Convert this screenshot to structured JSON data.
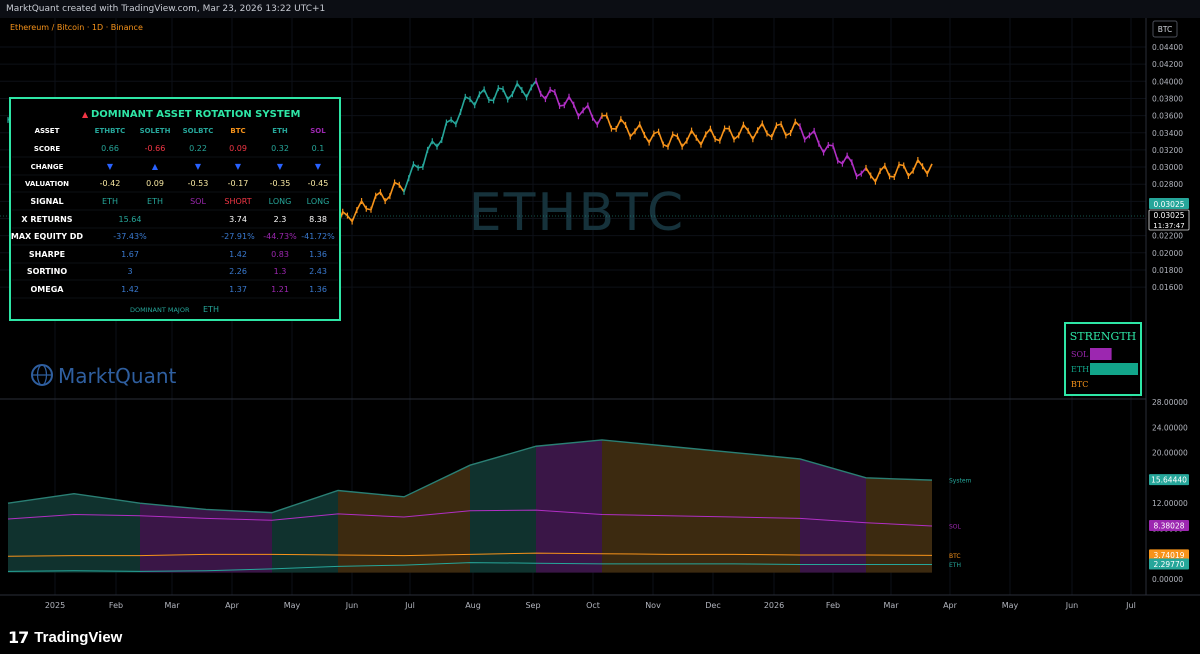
{
  "header": {
    "attribution": "MarktQuant created with TradingView.com, Mar 23, 2026 13:22 UTC+1"
  },
  "symbol": {
    "title": "Ethereum / Bitcoin · 1D · Binance",
    "watermark": "ETHBTC",
    "currency_badge": "BTC"
  },
  "brand": {
    "name": "MarktQuant"
  },
  "price_axis": {
    "ticks": [
      "0.04400",
      "0.04200",
      "0.04000",
      "0.03800",
      "0.03600",
      "0.03400",
      "0.03200",
      "0.03000",
      "0.02800",
      "0.02600",
      "0.02400",
      "0.02200",
      "0.02000",
      "0.01800",
      "0.01600"
    ],
    "last_price": "0.03025",
    "last_price_2": "0.03025",
    "countdown": "11:37:47"
  },
  "indicator_axis": {
    "ticks": [
      "28.00000",
      "24.00000",
      "20.00000",
      "16.00000",
      "12.00000",
      "8.00000",
      "4.00000",
      "0.00000"
    ],
    "labels": [
      {
        "name": "System",
        "value": "15.64440",
        "color": "#26a69a"
      },
      {
        "name": "SOL",
        "value": "8.38028",
        "color": "#9c27b0"
      },
      {
        "name": "BTC",
        "value": "3.74019",
        "color": "#f7931a"
      },
      {
        "name": "ETH",
        "value": "2.29770",
        "color": "#26a69a"
      }
    ]
  },
  "time_axis": [
    "2025",
    "Feb",
    "Mar",
    "Apr",
    "May",
    "Jun",
    "Jul",
    "Aug",
    "Sep",
    "Oct",
    "Nov",
    "Dec",
    "2026",
    "Feb",
    "Mar",
    "Apr",
    "May",
    "Jun",
    "Jul"
  ],
  "table": {
    "title": "DOMINANT ASSET ROTATION SYSTEM",
    "header": [
      "ASSET",
      "ETHBTC",
      "SOLETH",
      "SOLBTC",
      "BTC",
      "ETH",
      "SOL"
    ],
    "rows": [
      {
        "label": "SCORE",
        "cells": [
          "0.66",
          "-0.66",
          "0.22",
          "0.09",
          "0.32",
          "0.1"
        ]
      },
      {
        "label": "CHANGE",
        "cells": [
          "▼",
          "▲",
          "▼",
          "▼",
          "▼",
          "▼"
        ]
      },
      {
        "label": "VALUATION",
        "cells": [
          "-0.42",
          "0.09",
          "-0.53",
          "-0.17",
          "-0.35",
          "-0.45"
        ]
      },
      {
        "label": "SIGNAL",
        "cells": [
          "ETH",
          "ETH",
          "SOL",
          "SHORT",
          "LONG",
          "LONG"
        ]
      },
      {
        "label": "X RETURNS",
        "cells": [
          "15.64",
          "3.74",
          "2.3",
          "8.38"
        ]
      },
      {
        "label": "MAX EQUITY DD",
        "cells": [
          "-37.43%",
          "-27.91%",
          "-44.73%",
          "-41.72%"
        ]
      },
      {
        "label": "SHARPE",
        "cells": [
          "1.67",
          "1.42",
          "0.83",
          "1.36"
        ]
      },
      {
        "label": "SORTINO",
        "cells": [
          "3",
          "2.26",
          "1.3",
          "2.43"
        ]
      },
      {
        "label": "OMEGA",
        "cells": [
          "1.42",
          "1.37",
          "1.21",
          "1.36"
        ]
      }
    ],
    "footer_label": "DOMINANT MAJOR",
    "footer_value": "ETH"
  },
  "strength": {
    "title": "STRENGTH",
    "items": [
      {
        "label": "SOL",
        "level": 0.45,
        "color": "#9c27b0"
      },
      {
        "label": "ETH",
        "level": 1.0,
        "color": "#12a58a"
      },
      {
        "label": "BTC",
        "level": 0.0,
        "color": "#f7931a"
      }
    ]
  },
  "footer": {
    "brand": "TradingView"
  },
  "colors": {
    "eth": "#26a69a",
    "sol": "#b02fc4",
    "btc": "#f7931a",
    "accent": "#2ee6a6",
    "bg": "#000000"
  },
  "chart_data": {
    "type": "line",
    "title": "Ethereum / Bitcoin · 1D · Binance",
    "x": [
      "2025-01",
      "2025-02",
      "2025-03",
      "2025-04",
      "2025-05",
      "2025-06",
      "2025-07",
      "2025-08",
      "2025-09",
      "2025-10",
      "2025-11",
      "2025-12",
      "2026-01",
      "2026-02",
      "2026-03"
    ],
    "series": [
      {
        "name": "ETHBTC",
        "values": [
          0.0355,
          0.0275,
          0.0225,
          0.0185,
          0.024,
          0.0236,
          0.028,
          0.038,
          0.0392,
          0.0355,
          0.033,
          0.034,
          0.0345,
          0.029,
          0.0302
        ]
      },
      {
        "name": "System",
        "values": [
          12,
          13.5,
          12,
          11,
          10.5,
          14,
          13,
          18,
          21,
          22,
          21,
          20,
          19,
          16,
          15.64
        ]
      },
      {
        "name": "SOL",
        "values": [
          9.5,
          10.2,
          10,
          9.6,
          9.3,
          10.3,
          9.8,
          10.8,
          10.9,
          10.2,
          10,
          9.8,
          9.6,
          8.9,
          8.38
        ]
      },
      {
        "name": "BTC",
        "values": [
          3.6,
          3.7,
          3.7,
          3.9,
          3.9,
          3.8,
          3.7,
          3.9,
          4.1,
          4.0,
          3.9,
          3.9,
          3.8,
          3.8,
          3.74
        ]
      },
      {
        "name": "ETH",
        "values": [
          1.2,
          1.3,
          1.2,
          1.3,
          1.6,
          2.0,
          2.2,
          2.6,
          2.5,
          2.4,
          2.4,
          2.4,
          2.3,
          2.3,
          2.3
        ]
      }
    ],
    "ylim": [
      0.015,
      0.045
    ]
  }
}
